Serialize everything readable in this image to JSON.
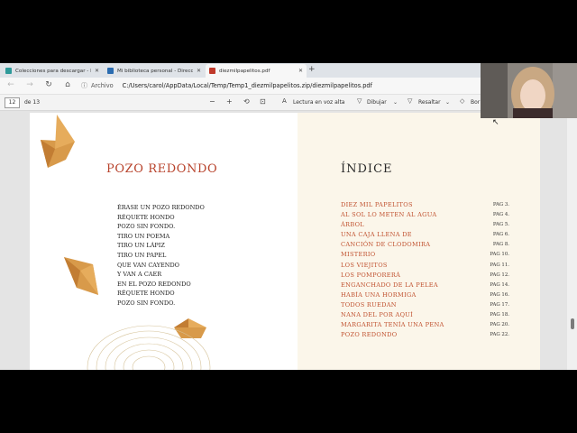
{
  "browser": {
    "tabs": [
      {
        "label": "Colecciones para descargar - Ed",
        "active": false,
        "favicon_color": "#2e9a9a"
      },
      {
        "label": "Mi biblioteca personal - Direcció",
        "active": false,
        "favicon_color": "#2b6cb0"
      },
      {
        "label": "diezmilpapelitos.pdf",
        "active": true,
        "favicon_color": "#c0392b"
      }
    ],
    "new_tab_label": "+",
    "address": {
      "back_icon": "arrow-left-icon",
      "forward_icon": "arrow-right-icon",
      "refresh_icon": "refresh-icon",
      "home_icon": "home-icon",
      "file_label": "Archivo",
      "url": "C:/Users/carol/AppData/Local/Temp/Temp1_diezmilpapelitos.zip/diezmilpapelitos.pdf"
    }
  },
  "pdf_toolbar": {
    "page_number": "12",
    "page_total": "de 13",
    "zoom_out": "−",
    "zoom_in": "+",
    "read_aloud": "Lectura en voz alta",
    "draw": "Dibujar",
    "highlight": "Resaltar",
    "erase": "Bor"
  },
  "left_page": {
    "title": "POZO REDONDO",
    "poem_lines": [
      "ÉRASE UN POZO REDONDO",
      "RÉQUETE HONDO",
      "POZO SIN FONDO.",
      "TIRO UN POEMA",
      "TIRO UN LÁPIZ",
      "TIRO UN PAPEL",
      "QUE VAN CAYENDO",
      "Y VAN A CAER",
      "EN EL POZO REDONDO",
      "RÉQUETE HONDO",
      "POZO SIN FONDO."
    ]
  },
  "right_page": {
    "title": "ÍNDICE",
    "entries": [
      {
        "title": "DIEZ MIL PAPELITOS",
        "page": "PAG 3."
      },
      {
        "title": "AL SOL LO METEN AL AGUA",
        "page": "PAG 4."
      },
      {
        "title": "ÁRBOL",
        "page": "PAG 5."
      },
      {
        "title": "UNA CAJA LLENA DE",
        "page": "PAG 6."
      },
      {
        "title": "CANCIÓN DE CLODOMIRA",
        "page": "PAG 8."
      },
      {
        "title": "MISTERIO",
        "page": "PAG 10."
      },
      {
        "title": "LOS VIEJITOS",
        "page": "PAG 11."
      },
      {
        "title": "LOS POMPORERÁ",
        "page": "PAG 12."
      },
      {
        "title": "ENGANCHADO DE LA PELEA",
        "page": "PAG 14."
      },
      {
        "title": "HABÍA UNA HORMIGA",
        "page": "PAG 16."
      },
      {
        "title": "TODOS RUEDAN",
        "page": "PAG 17."
      },
      {
        "title": "NANA DEL POR AQUÍ",
        "page": "PAG 18."
      },
      {
        "title": "MARGARITA TENÍA UNA PENA",
        "page": "PAG 20."
      },
      {
        "title": "POZO REDONDO",
        "page": "PAG 22."
      }
    ]
  },
  "colors": {
    "accent_red": "#b8432c",
    "index_title_color": "#c0512f",
    "paper_orange": "#d89a4a"
  }
}
